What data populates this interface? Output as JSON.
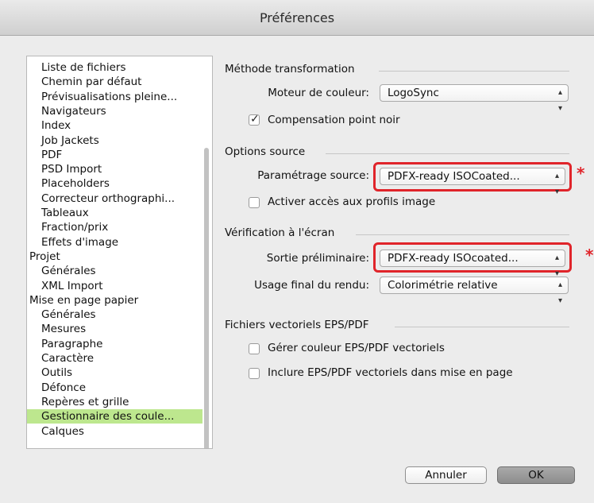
{
  "window": {
    "title": "Préférences"
  },
  "sidebar": {
    "items": [
      {
        "label": "Liste de fichiers",
        "level": "child"
      },
      {
        "label": "Chemin par défaut",
        "level": "child"
      },
      {
        "label": "Prévisualisations pleine...",
        "level": "child"
      },
      {
        "label": "Navigateurs",
        "level": "child"
      },
      {
        "label": "Index",
        "level": "child"
      },
      {
        "label": "Job Jackets",
        "level": "child"
      },
      {
        "label": "PDF",
        "level": "child"
      },
      {
        "label": "PSD Import",
        "level": "child"
      },
      {
        "label": "Placeholders",
        "level": "child"
      },
      {
        "label": "Correcteur orthographi...",
        "level": "child"
      },
      {
        "label": "Tableaux",
        "level": "child"
      },
      {
        "label": "Fraction/prix",
        "level": "child"
      },
      {
        "label": "Effets d'image",
        "level": "child"
      },
      {
        "label": "Projet",
        "level": "parent"
      },
      {
        "label": "Générales",
        "level": "child"
      },
      {
        "label": "XML Import",
        "level": "child"
      },
      {
        "label": "Mise en page papier",
        "level": "parent"
      },
      {
        "label": "Générales",
        "level": "child"
      },
      {
        "label": "Mesures",
        "level": "child"
      },
      {
        "label": "Paragraphe",
        "level": "child"
      },
      {
        "label": "Caractère",
        "level": "child"
      },
      {
        "label": "Outils",
        "level": "child"
      },
      {
        "label": "Défonce",
        "level": "child"
      },
      {
        "label": "Repères et grille",
        "level": "child"
      },
      {
        "label": "Gestionnaire des coule...",
        "level": "child",
        "selected": true
      },
      {
        "label": "Calques",
        "level": "child"
      }
    ]
  },
  "sections": {
    "methode": {
      "heading": "Méthode transformation",
      "moteur_label": "Moteur de couleur:",
      "moteur_value": "LogoSync",
      "compensation_label": "Compensation point noir",
      "compensation_checked": true
    },
    "source": {
      "heading": "Options source",
      "parametrage_label": "Paramétrage source:",
      "parametrage_value": "PDFX-ready ISOCoated...",
      "activer_label": "Activer accès aux profils image",
      "activer_checked": false
    },
    "verification": {
      "heading": "Vérification à l'écran",
      "sortie_label": "Sortie préliminaire:",
      "sortie_value": "PDFX-ready ISOcoated...",
      "usage_label": "Usage final du rendu:",
      "usage_value": "Colorimétrie relative"
    },
    "vectoriels": {
      "heading": "Fichiers vectoriels EPS/PDF",
      "gerer_label": "Gérer couleur EPS/PDF vectoriels",
      "gerer_checked": false,
      "inclure_label": "Inclure EPS/PDF vectoriels dans mise en page",
      "inclure_checked": false
    }
  },
  "annotations": {
    "asterisk": "*",
    "highlight_color": "#e0242a"
  },
  "buttons": {
    "cancel": "Annuler",
    "ok": "OK"
  },
  "icons": {
    "popup_arrows": "⌃⌄",
    "checkmark": "✓"
  },
  "colors": {
    "selection": "#bde78e"
  }
}
